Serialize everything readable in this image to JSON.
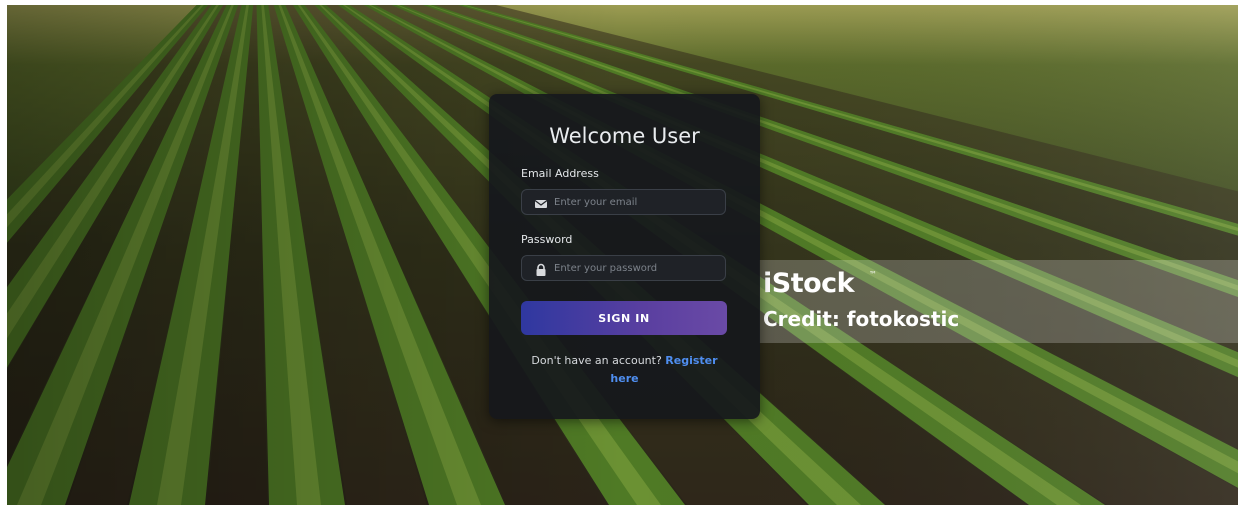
{
  "login": {
    "title": "Welcome User",
    "email_label": "Email Address",
    "email_placeholder": "Enter your email",
    "email_value": "",
    "password_label": "Password",
    "password_placeholder": "Enter your password",
    "password_value": "",
    "signin_label": "SIGN IN",
    "register_prompt": "Don't have an account?",
    "register_link_1": "Register",
    "register_link_2": "here"
  },
  "watermark": {
    "brand": "iStock",
    "trademark": "™",
    "credit": "Credit: fotokostic"
  },
  "icons": {
    "email": "envelope-icon",
    "password": "lock-icon"
  },
  "colors": {
    "card_bg": "#16181c",
    "signin_gradient_start": "#2f38a0",
    "signin_gradient_end": "#6a4aa6",
    "link": "#4f8ef0"
  }
}
